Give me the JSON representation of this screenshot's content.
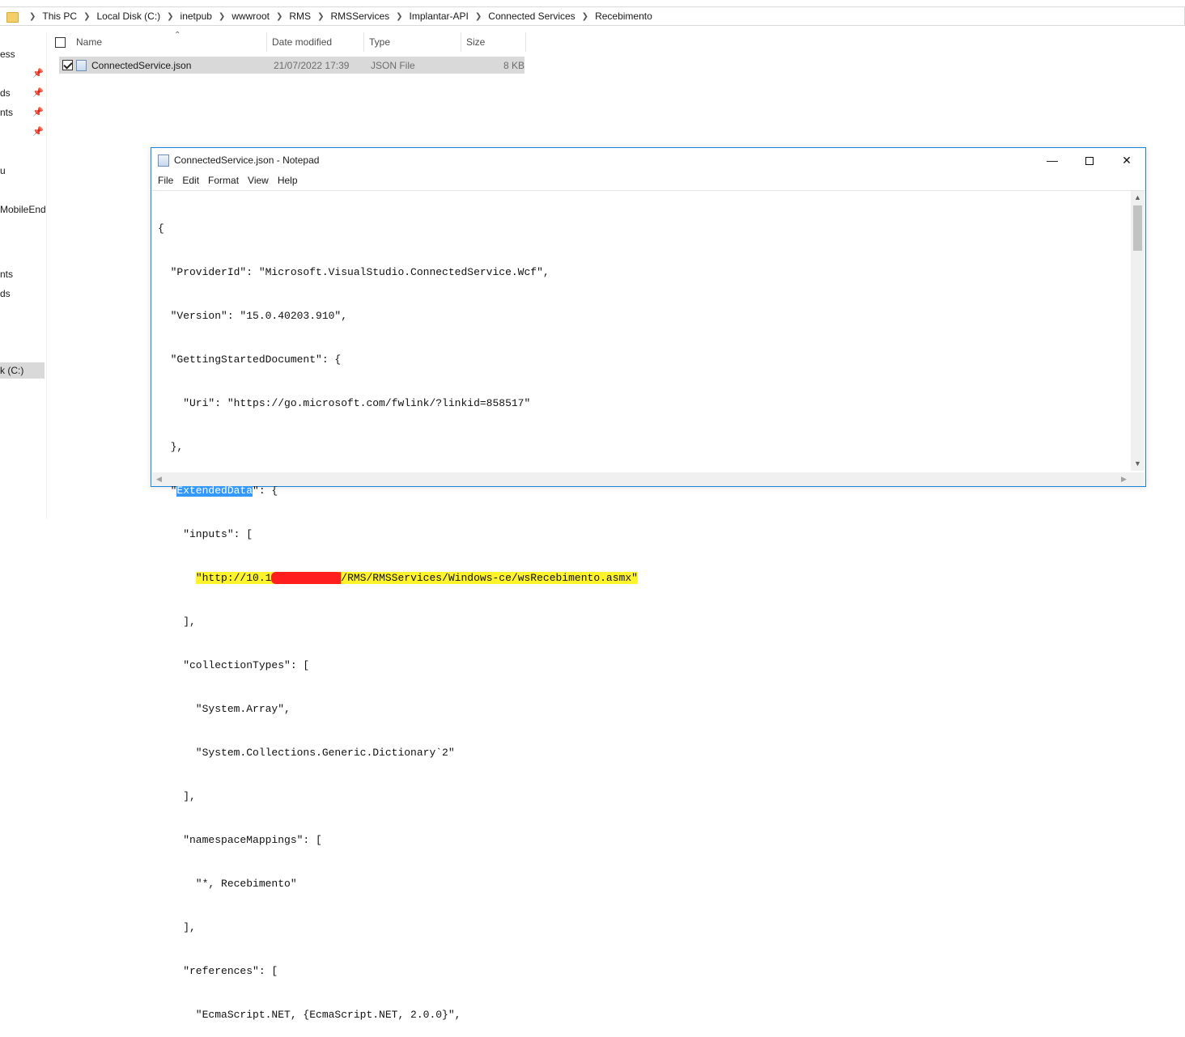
{
  "breadcrumb": [
    "This PC",
    "Local Disk (C:)",
    "inetpub",
    "wwwroot",
    "RMS",
    "RMSServices",
    "Implantar-API",
    "Connected Services",
    "Recebimento"
  ],
  "nav": {
    "items": [
      "ess",
      "ds",
      "nts",
      "u",
      "MobileEnd",
      "nts",
      "ds",
      "k (C:)"
    ]
  },
  "columns": {
    "name": "Name",
    "date": "Date modified",
    "type": "Type",
    "size": "Size"
  },
  "file": {
    "name": "ConnectedService.json",
    "date": "21/07/2022 17:39",
    "type": "JSON File",
    "size": "8 KB"
  },
  "notepad": {
    "title": "ConnectedService.json - Notepad",
    "menu": [
      "File",
      "Edit",
      "Format",
      "View",
      "Help"
    ],
    "lines": [
      "{",
      "  \"ProviderId\": \"Microsoft.VisualStudio.ConnectedService.Wcf\",",
      "  \"Version\": \"15.0.40203.910\",",
      "  \"GettingStartedDocument\": {",
      "    \"Uri\": \"https://go.microsoft.com/fwlink/?linkid=858517\"",
      "  },",
      "  \"",
      "    \"inputs\": [",
      "      ",
      "    ],",
      "    \"collectionTypes\": [",
      "      \"System.Array\",",
      "      \"System.Collections.Generic.Dictionary`2\"",
      "    ],",
      "    \"namespaceMappings\": [",
      "      \"*, Recebimento\"",
      "    ],",
      "    \"references\": [",
      "      \"EcmaScript.NET, {EcmaScript.NET, 2.0.0}\","
    ],
    "selected_word": "ExtendedData",
    "after_selected": "\": {",
    "url_prefix": "\"http://10.1",
    "url_redacted": "7██████████",
    "url_suffix": "/RMS/RMSServices/Windows-ce/wsRecebimento.asmx\""
  }
}
